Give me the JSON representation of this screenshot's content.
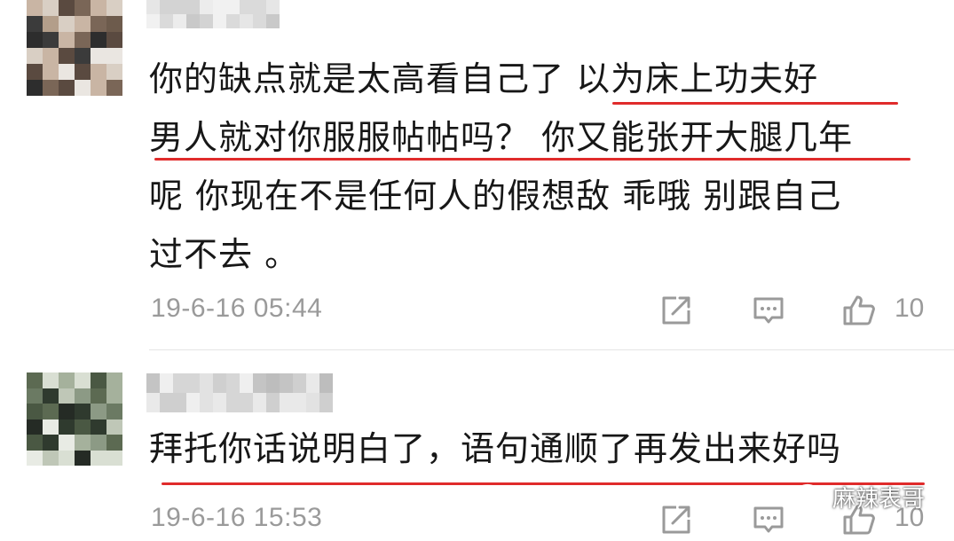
{
  "comments": [
    {
      "id": "c1",
      "text_lines": [
        "你的缺点就是太高看自己了 以为床上功夫好",
        "男人就对你服服帖帖吗？ 你又能张开大腿几年",
        "呢 你现在不是任何人的假想敌 乖哦 别跟自己",
        "过不去 。"
      ],
      "timestamp": "19-6-16 05:44",
      "like_count": "10"
    },
    {
      "id": "c2",
      "text_lines": [
        "拜托你话说明白了，语句通顺了再发出来好吗"
      ],
      "timestamp": "19-6-16 15:53",
      "like_count": "10"
    }
  ],
  "watermark": {
    "text": "麻辣表哥",
    "icon": "wechat-icon"
  },
  "icons": {
    "share": "share-icon",
    "reply": "comment-icon",
    "like": "thumbs-up-icon"
  },
  "colors": {
    "underline": "#e02b2b",
    "meta_text": "#9a9a9a",
    "body_text": "#171717",
    "divider": "#e4e4e4"
  }
}
